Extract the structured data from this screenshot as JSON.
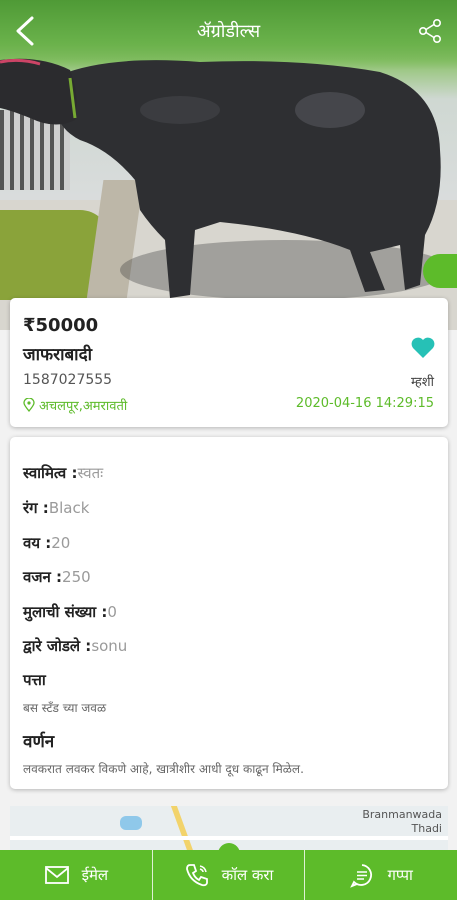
{
  "appbar": {
    "title": "ॲग्रोडील्स",
    "back_icon": "back-chevron-icon",
    "share_icon": "share-icon"
  },
  "listing": {
    "price": "₹50000",
    "breed": "जाफराबादी",
    "phone": "1587027555",
    "location": "अचलपूर,अमरावती",
    "language": "म्हशी",
    "posted_at": "2020-04-16 14:29:15",
    "favorite_icon": "heart-icon"
  },
  "details": {
    "ownership": {
      "label": "स्वामित्व :",
      "value": "स्वतः"
    },
    "color": {
      "label": "रंग :",
      "value": "Black"
    },
    "age": {
      "label": "वय :",
      "value": "20"
    },
    "weight": {
      "label": "वजन :",
      "value": "250"
    },
    "children": {
      "label": "मुलाची संख्या :",
      "value": "0"
    },
    "added_by": {
      "label": "द्वारे जोडले :",
      "value": "sonu"
    },
    "address": {
      "label": "पत्ता",
      "value": "बस स्टँड च्या जवळ"
    },
    "description": {
      "label": "वर्णन",
      "value": "लवकरात लवकर विकणे आहे, खात्रीशीर आधी दूध काढून मिळेल."
    }
  },
  "map": {
    "place_label_1": "Branmanwada",
    "place_label_2": "Thadi"
  },
  "bottom_bar": {
    "email_label": "ईमेल",
    "call_label": "कॉल करा",
    "chat_label": "गप्पा"
  },
  "colors": {
    "accent": "#5dbb2a",
    "heart": "#26c1b6"
  }
}
